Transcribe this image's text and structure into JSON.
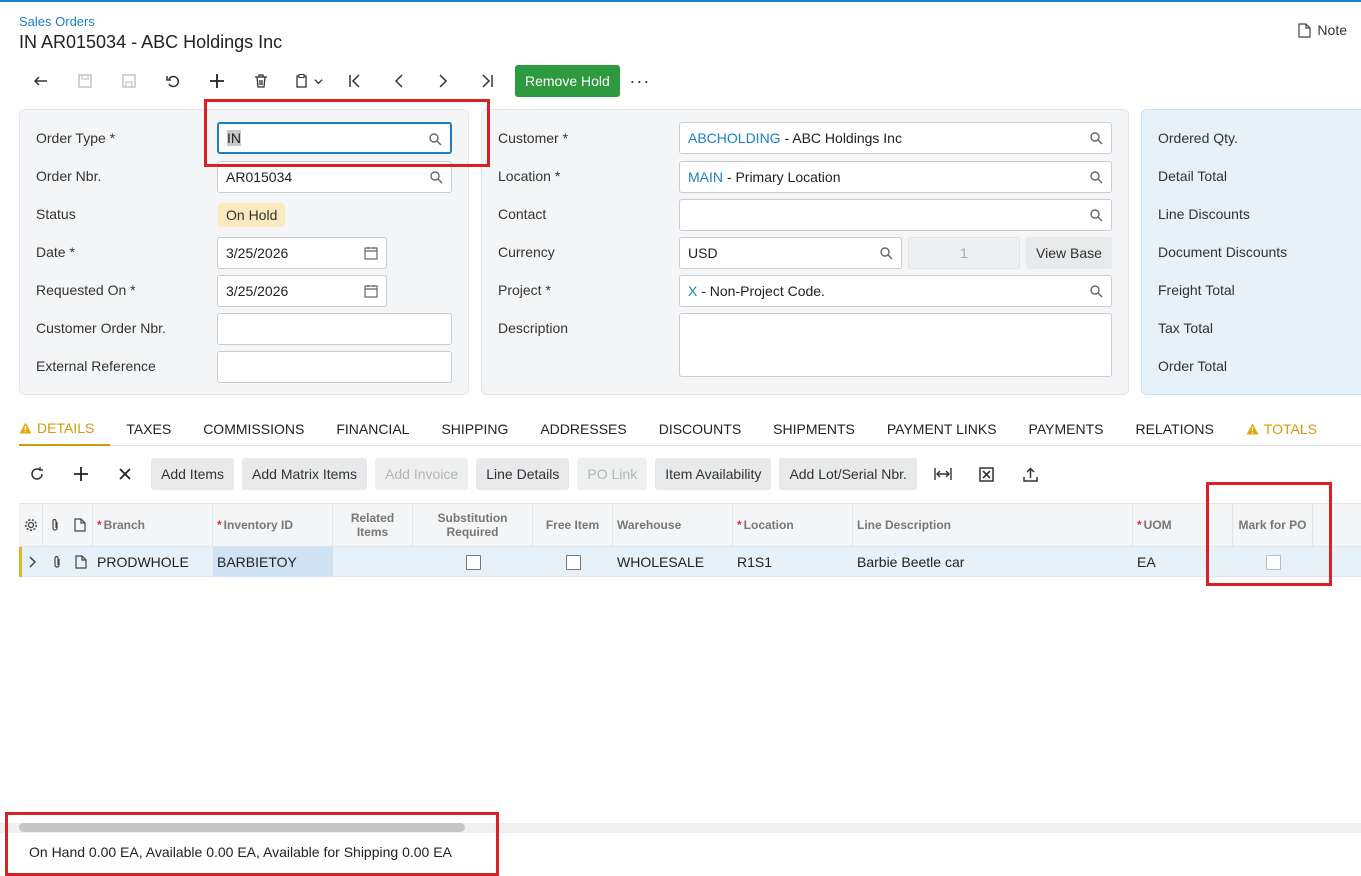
{
  "header": {
    "breadcrumb": "Sales Orders",
    "title": "IN AR015034 - ABC Holdings Inc",
    "note_label": "Note"
  },
  "toolbar": {
    "remove_hold_label": "Remove Hold",
    "more_label": "···",
    "accent_color": "#2e9a3f"
  },
  "summary": {
    "order_type_label": "Order Type *",
    "order_type_value": "IN",
    "order_nbr_label": "Order Nbr.",
    "order_nbr_value": "AR015034",
    "status_label": "Status",
    "status_value": "On Hold",
    "date_label": "Date *",
    "date_value": "3/25/2026",
    "requested_on_label": "Requested On *",
    "requested_on_value": "3/25/2026",
    "customer_order_nbr_label": "Customer Order Nbr.",
    "external_reference_label": "External Reference",
    "customer_label": "Customer *",
    "customer_id": "ABCHOLDING",
    "customer_name": " - ABC Holdings Inc",
    "location_label": "Location *",
    "location_id": "MAIN",
    "location_name": " - Primary Location",
    "contact_label": "Contact",
    "currency_label": "Currency",
    "currency_value": "USD",
    "currency_rate": "1",
    "view_base_label": "View Base",
    "project_label": "Project *",
    "project_id": "X",
    "project_name": " - Non-Project Code.",
    "description_label": "Description"
  },
  "totals": {
    "ordered_qty_label": "Ordered Qty.",
    "detail_total_label": "Detail Total",
    "line_discounts_label": "Line Discounts",
    "document_discounts_label": "Document Discounts",
    "freight_total_label": "Freight Total",
    "tax_total_label": "Tax Total",
    "order_total_label": "Order Total"
  },
  "tabs": [
    {
      "label": "DETAILS"
    },
    {
      "label": "TAXES"
    },
    {
      "label": "COMMISSIONS"
    },
    {
      "label": "FINANCIAL"
    },
    {
      "label": "SHIPPING"
    },
    {
      "label": "ADDRESSES"
    },
    {
      "label": "DISCOUNTS"
    },
    {
      "label": "SHIPMENTS"
    },
    {
      "label": "PAYMENT LINKS"
    },
    {
      "label": "PAYMENTS"
    },
    {
      "label": "RELATIONS"
    },
    {
      "label": "TOTALS"
    }
  ],
  "grid_toolbar": {
    "add_items": "Add Items",
    "add_matrix_items": "Add Matrix Items",
    "add_invoice": "Add Invoice",
    "line_details": "Line Details",
    "po_link": "PO Link",
    "item_availability": "Item Availability",
    "add_lot_serial": "Add Lot/Serial Nbr."
  },
  "grid": {
    "headers": {
      "branch": "Branch",
      "inventory_id": "Inventory ID",
      "related_items": "Related Items",
      "substitution_required": "Substitution Required",
      "free_item": "Free Item",
      "warehouse": "Warehouse",
      "location": "Location",
      "line_description": "Line Description",
      "uom": "UOM",
      "mark_for_po": "Mark for PO"
    },
    "rows": [
      {
        "branch": "PRODWHOLE",
        "inventory_id": "BARBIETOY",
        "warehouse": "WHOLESALE",
        "location": "R1S1",
        "line_description": "Barbie Beetle car",
        "uom": "EA"
      }
    ]
  },
  "status_bar": {
    "text": "On Hand 0.00 EA, Available 0.00 EA, Available for Shipping 0.00 EA"
  }
}
